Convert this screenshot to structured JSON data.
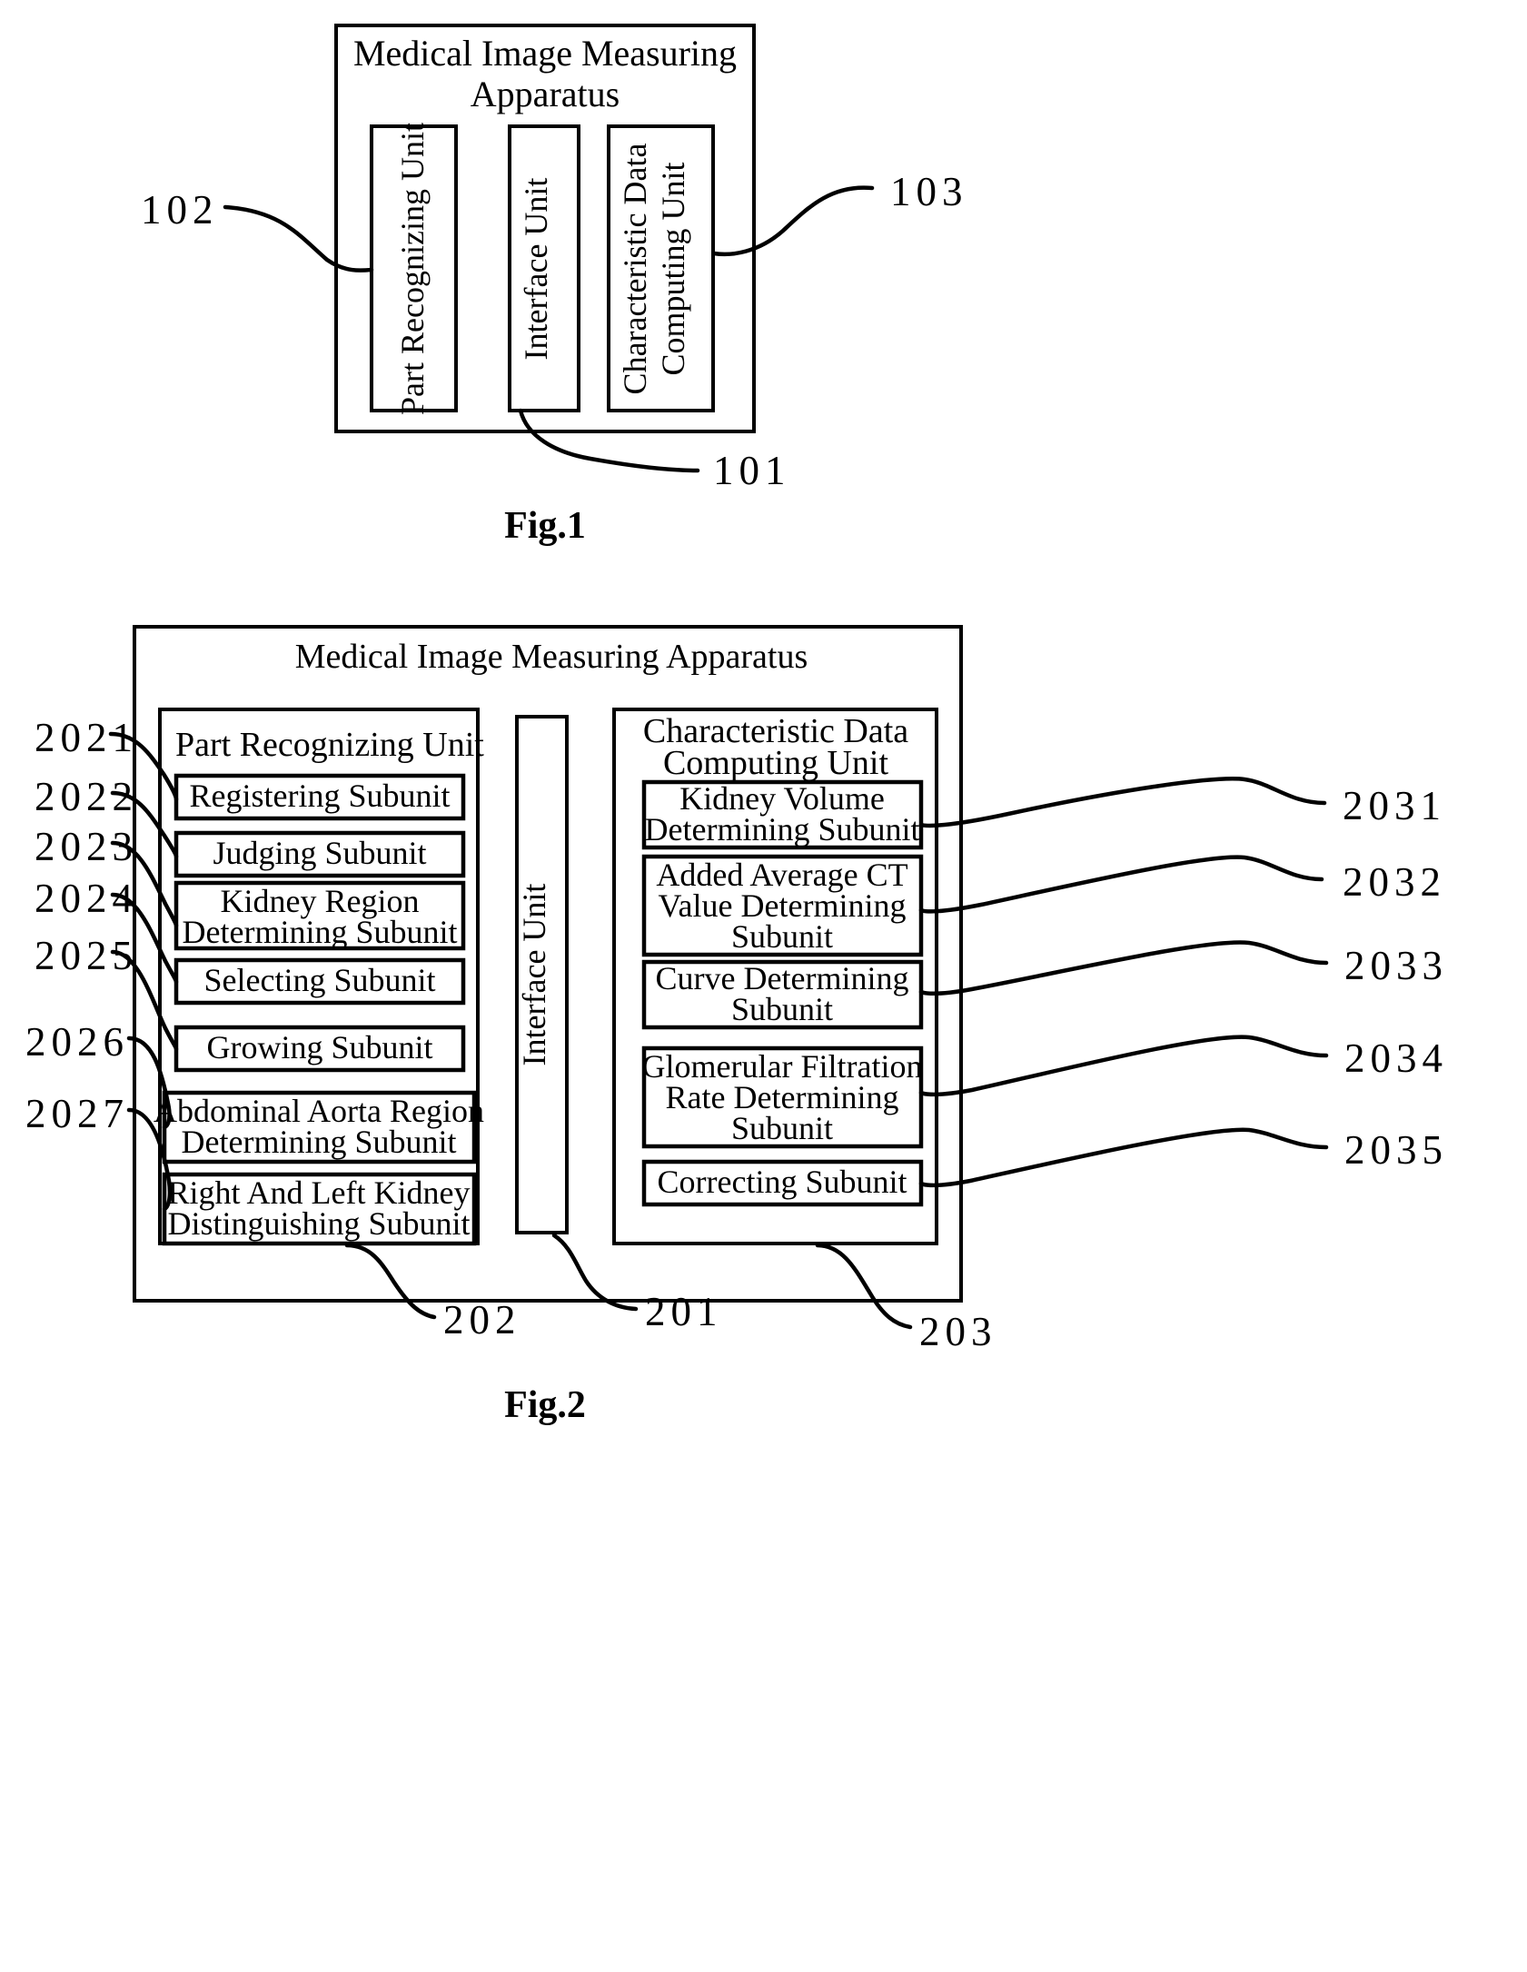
{
  "figure1": {
    "caption": "Fig.1",
    "apparatus_title_line1": "Medical Image Measuring",
    "apparatus_title_line2": "Apparatus",
    "units": [
      {
        "label": "Part Recognizing Unit",
        "ref": "102"
      },
      {
        "label": "Interface Unit",
        "ref": "101"
      },
      {
        "label_line1": "Characteristic Data",
        "label_line2": "Computing Unit",
        "ref": "103"
      }
    ],
    "refs": {
      "part_recognizing": "102",
      "interface": "101",
      "characteristic_data": "103"
    }
  },
  "figure2": {
    "caption": "Fig.2",
    "apparatus_title": "Medical Image Measuring Apparatus",
    "apparatus_ref": "201",
    "part_recognizing_unit": {
      "title": "Part Recognizing Unit",
      "ref": "202",
      "subunits": [
        {
          "ref": "2021",
          "lines": [
            "Registering Subunit"
          ]
        },
        {
          "ref": "2022",
          "lines": [
            "Judging Subunit"
          ]
        },
        {
          "ref": "2023",
          "lines": [
            "Kidney Region",
            "Determining Subunit"
          ]
        },
        {
          "ref": "2024",
          "lines": [
            "Selecting Subunit"
          ]
        },
        {
          "ref": "2025",
          "lines": [
            "Growing Subunit"
          ]
        },
        {
          "ref": "2026",
          "lines": [
            "Abdominal Aorta Region",
            "Determining Subunit"
          ]
        },
        {
          "ref": "2027",
          "lines": [
            "Right And Left Kidney",
            "Distinguishing Subunit"
          ]
        }
      ]
    },
    "interface_unit": {
      "title": "Interface Unit",
      "ref": "201"
    },
    "characteristic_data_unit": {
      "title_line1": "Characteristic Data",
      "title_line2": "Computing Unit",
      "ref": "203",
      "subunits": [
        {
          "ref": "2031",
          "lines": [
            "Kidney Volume",
            "Determining Subunit"
          ]
        },
        {
          "ref": "2032",
          "lines": [
            "Added Average CT",
            "Value Determining",
            "Subunit"
          ]
        },
        {
          "ref": "2033",
          "lines": [
            "Curve Determining",
            "Subunit"
          ]
        },
        {
          "ref": "2034",
          "lines": [
            "Glomerular Filtration",
            "Rate Determining",
            "Subunit"
          ]
        },
        {
          "ref": "2035",
          "lines": [
            "Correcting Subunit"
          ]
        }
      ]
    }
  },
  "colors": {
    "ink": "#000000",
    "paper": "#ffffff"
  }
}
